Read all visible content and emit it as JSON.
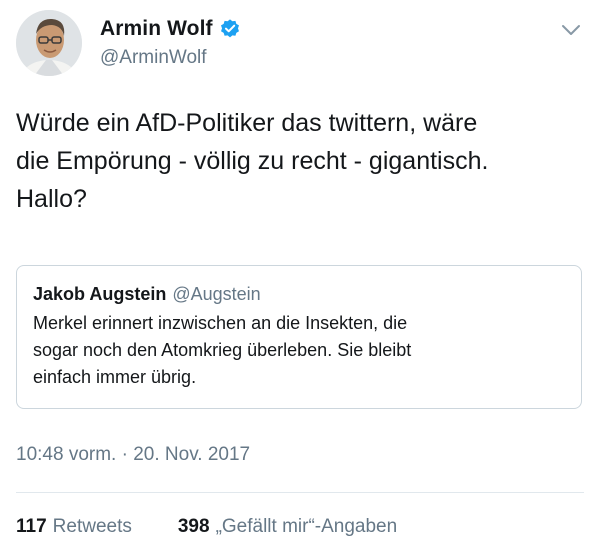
{
  "author": {
    "display_name": "Armin Wolf",
    "handle": "@ArminWolf",
    "verified": true,
    "avatar_icon": "profile-photo"
  },
  "menu_icon": "chevron-down-icon",
  "tweet": {
    "text_lines": [
      "Würde ein AfD-Politiker das twittern, wäre",
      "die Empörung - völlig zu recht - gigantisch.",
      "Hallo?"
    ]
  },
  "quoted_tweet": {
    "display_name": "Jakob Augstein",
    "handle": "@Augstein",
    "text_lines": [
      "Merkel erinnert inzwischen an die Insekten, die",
      "sogar noch den Atomkrieg überleben. Sie bleibt",
      "einfach immer übrig."
    ]
  },
  "timestamp": "10:48 vorm. · 20. Nov. 2017",
  "stats": {
    "retweets_count": "117",
    "retweets_label": "Retweets",
    "likes_count": "398",
    "likes_label": "„Gefällt mir“-Angaben"
  },
  "colors": {
    "verified_badge": "#1da1f2",
    "secondary_text": "#657786",
    "border": "#ccd6dd"
  }
}
